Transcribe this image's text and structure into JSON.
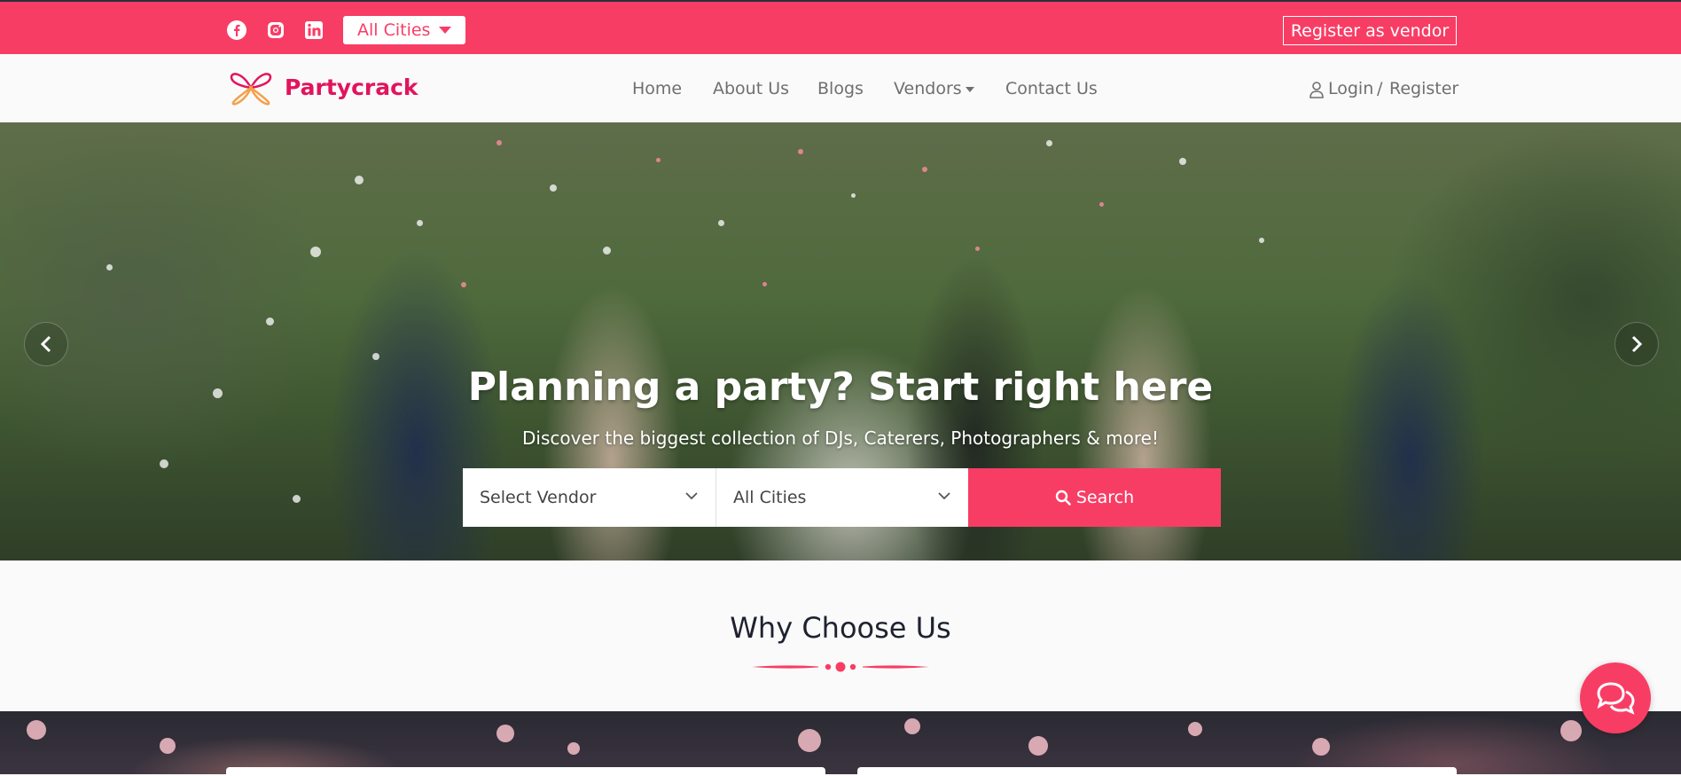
{
  "topbar": {
    "social": [
      "facebook-icon",
      "instagram-icon",
      "linkedin-icon"
    ],
    "city_select": "All Cities",
    "register_vendor": "Register as vendor"
  },
  "navbar": {
    "brand": "Partycrack",
    "items": [
      "Home",
      "About Us",
      "Blogs",
      "Vendors",
      "Contact Us"
    ],
    "login": "Login",
    "separator": "/",
    "register": "Register"
  },
  "hero": {
    "title": "Planning a party? Start right here",
    "subtitle": "Discover the biggest collection of DJs, Caterers, Photographers & more!",
    "vendor_select": "Select Vendor",
    "city_select": "All Cities",
    "search_label": "Search"
  },
  "why": {
    "title": "Why Choose Us"
  },
  "colors": {
    "brand_pink": "#f83d65",
    "brand_dark_pink": "#e2145d",
    "nav_text": "#6f6f6f"
  }
}
